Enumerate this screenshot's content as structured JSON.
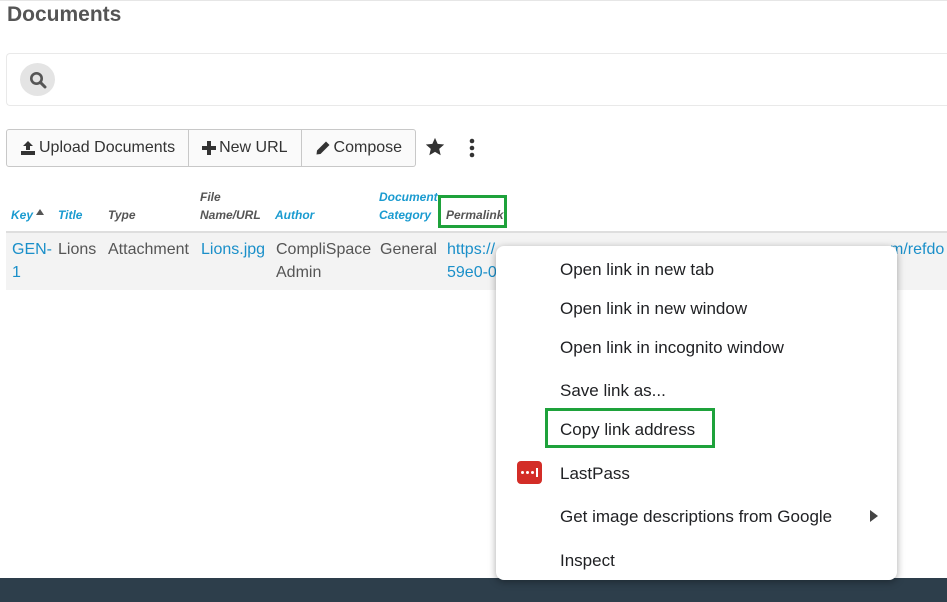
{
  "page": {
    "title": "Documents"
  },
  "toolbar": {
    "upload_label": "Upload Documents",
    "new_url_label": "New URL",
    "compose_label": "Compose"
  },
  "table": {
    "columns": [
      {
        "label": "Key",
        "sorted": "ascending"
      },
      {
        "label": "Title"
      },
      {
        "label": "Type"
      },
      {
        "label_line1": "File",
        "label_line2": "Name/URL"
      },
      {
        "label": "Author"
      },
      {
        "label_line1": "Document",
        "label_line2": "Category"
      },
      {
        "label": "Permalink"
      }
    ],
    "rows": [
      {
        "key_line1": "GEN-",
        "key_line2": "1",
        "title": "Lions",
        "type": "Attachment",
        "file": "Lions.jpg",
        "author_line1": "CompliSpace",
        "author_line2": "Admin",
        "category": "General",
        "permalink_line1": "https://",
        "permalink_tail": "m/refdo",
        "permalink_line2": "59e0-0"
      }
    ]
  },
  "context_menu": {
    "items": [
      "Open link in new tab",
      "Open link in new window",
      "Open link in incognito window",
      "Save link as...",
      "Copy link address",
      "LastPass",
      "Get image descriptions from Google",
      "Inspect"
    ],
    "lastpass_color": "#d32d27"
  },
  "colors": {
    "accent_link": "#1a8fc9",
    "header_blue": "#1a9bd0",
    "highlight": "#1ea23b",
    "footer": "#2d3e4b"
  }
}
